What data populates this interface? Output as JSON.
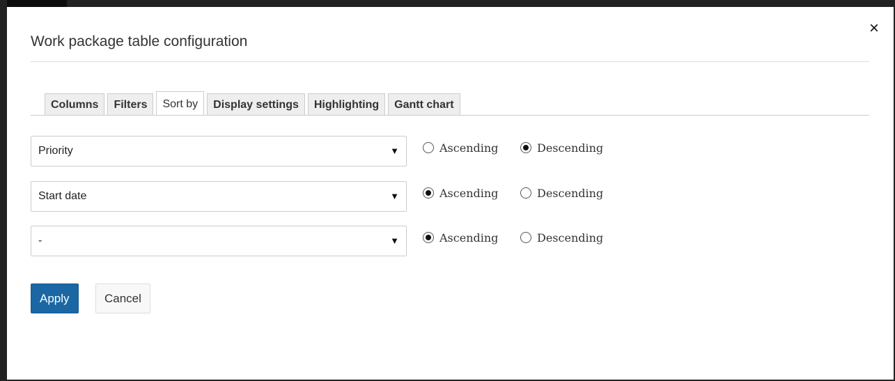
{
  "dialog": {
    "title": "Work package table configuration",
    "close_icon": "×"
  },
  "tabs": [
    {
      "label": "Columns",
      "active": false
    },
    {
      "label": "Filters",
      "active": false
    },
    {
      "label": "Sort by",
      "active": true
    },
    {
      "label": "Display settings",
      "active": false
    },
    {
      "label": "Highlighting",
      "active": false
    },
    {
      "label": "Gantt chart",
      "active": false
    }
  ],
  "sort_rows": [
    {
      "field": "Priority",
      "asc_label": "Ascending",
      "desc_label": "Descending",
      "selected": "Descending"
    },
    {
      "field": "Start date",
      "asc_label": "Ascending",
      "desc_label": "Descending",
      "selected": "Ascending"
    },
    {
      "field": "-",
      "asc_label": "Ascending",
      "desc_label": "Descending",
      "selected": "Ascending"
    }
  ],
  "select_caret": "▼",
  "buttons": {
    "apply": "Apply",
    "cancel": "Cancel"
  },
  "colors": {
    "primary": "#1a67a3",
    "frame": "#222222"
  }
}
